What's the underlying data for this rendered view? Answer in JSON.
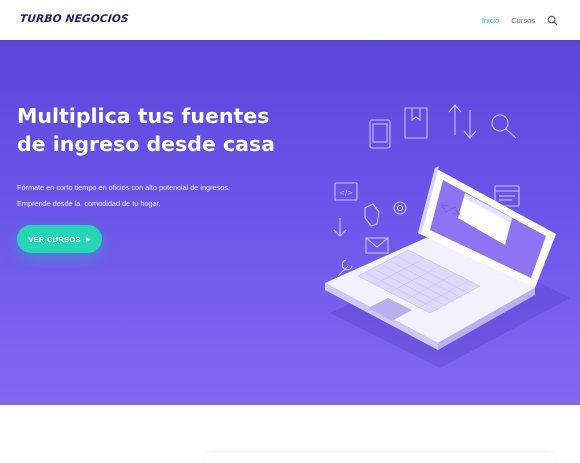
{
  "brand": {
    "logo_text": "TURBO NEGOCIOS"
  },
  "nav": {
    "items": [
      {
        "label": "Inicio",
        "active": true
      },
      {
        "label": "Cursos",
        "active": false
      }
    ],
    "search_icon": "search-icon"
  },
  "hero": {
    "title": "Multiplica tus fuentes de ingreso desde casa",
    "subtitle_lines": [
      "Fórmate en corto tiempo en oficios con alto potencial de ingresos.",
      "Emprende desde la  comodidad de tu hogar."
    ],
    "cta_label": "VER CURSOS",
    "cta_icon": "caret-right-icon",
    "illustration": "laptop-code-illustration"
  },
  "colors": {
    "accent": "#2ea3f2",
    "hero_top": "#5a47d9",
    "hero_bottom": "#8468f0",
    "cta": "#26d4b6"
  }
}
